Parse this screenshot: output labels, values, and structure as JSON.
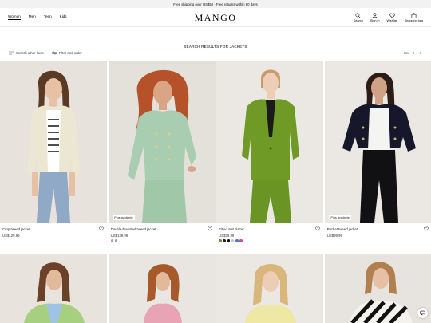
{
  "promo": {
    "text": "Free shipping over US$50 · Free returns within 60 days"
  },
  "header": {
    "logo": "MANGO",
    "nav": [
      "Women",
      "Men",
      "Teen",
      "Kids"
    ],
    "utilities": {
      "search": "Search",
      "signin": "Sign in",
      "wishlist": "Wishlist",
      "bag": "Shopping bag"
    }
  },
  "results": {
    "title": "SEARCH RESULTS FOR JACKETS"
  },
  "filters": {
    "search_other": "Search other lines",
    "filter_order": "Filter and order",
    "see_label": "See",
    "see_options": [
      "2",
      "4"
    ]
  },
  "products": [
    {
      "name": "Crop tweed jacket",
      "price": "US$129.99",
      "badge": "",
      "swatches": []
    },
    {
      "name": "Double-breasted tweed jacket",
      "price": "US$139.99",
      "badge": "Plus available",
      "swatches": [
        "#e88aa0",
        "#9a9fba"
      ]
    },
    {
      "name": "Fitted suit blazer",
      "price": "US$79.99",
      "badge": "",
      "swatches": [
        "#6f8f2e",
        "#222222",
        "#111111",
        "#c9c4bc",
        "#3d7fd6",
        "#d04a9e"
      ]
    },
    {
      "name": "Pocket tweed jacket",
      "price": "US$99.99",
      "badge": "Plus available",
      "swatches": []
    }
  ],
  "colors": {
    "accent": "#000000",
    "promo_bg": "#f2f2f2",
    "badge_bg": "#ffffff"
  },
  "icons": {
    "search": "search-icon",
    "signin": "user-icon",
    "wishlist": "heart-icon",
    "bag": "bag-icon",
    "chat": "chat-icon"
  }
}
